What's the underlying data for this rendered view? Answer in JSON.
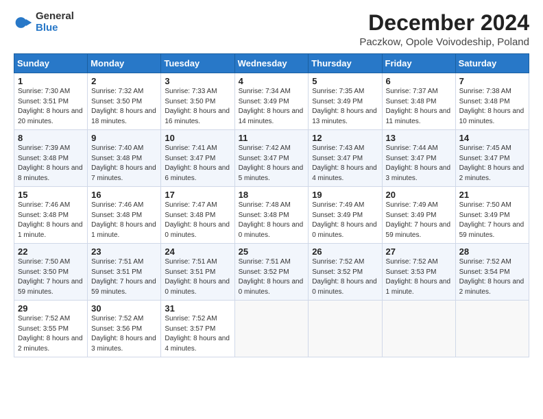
{
  "logo": {
    "general": "General",
    "blue": "Blue"
  },
  "calendar": {
    "title": "December 2024",
    "subtitle": "Paczkow, Opole Voivodeship, Poland",
    "headers": [
      "Sunday",
      "Monday",
      "Tuesday",
      "Wednesday",
      "Thursday",
      "Friday",
      "Saturday"
    ],
    "weeks": [
      [
        {
          "day": "1",
          "sunrise": "7:30 AM",
          "sunset": "3:51 PM",
          "daylight": "8 hours and 20 minutes."
        },
        {
          "day": "2",
          "sunrise": "7:32 AM",
          "sunset": "3:50 PM",
          "daylight": "8 hours and 18 minutes."
        },
        {
          "day": "3",
          "sunrise": "7:33 AM",
          "sunset": "3:50 PM",
          "daylight": "8 hours and 16 minutes."
        },
        {
          "day": "4",
          "sunrise": "7:34 AM",
          "sunset": "3:49 PM",
          "daylight": "8 hours and 14 minutes."
        },
        {
          "day": "5",
          "sunrise": "7:35 AM",
          "sunset": "3:49 PM",
          "daylight": "8 hours and 13 minutes."
        },
        {
          "day": "6",
          "sunrise": "7:37 AM",
          "sunset": "3:48 PM",
          "daylight": "8 hours and 11 minutes."
        },
        {
          "day": "7",
          "sunrise": "7:38 AM",
          "sunset": "3:48 PM",
          "daylight": "8 hours and 10 minutes."
        }
      ],
      [
        {
          "day": "8",
          "sunrise": "7:39 AM",
          "sunset": "3:48 PM",
          "daylight": "8 hours and 8 minutes."
        },
        {
          "day": "9",
          "sunrise": "7:40 AM",
          "sunset": "3:48 PM",
          "daylight": "8 hours and 7 minutes."
        },
        {
          "day": "10",
          "sunrise": "7:41 AM",
          "sunset": "3:47 PM",
          "daylight": "8 hours and 6 minutes."
        },
        {
          "day": "11",
          "sunrise": "7:42 AM",
          "sunset": "3:47 PM",
          "daylight": "8 hours and 5 minutes."
        },
        {
          "day": "12",
          "sunrise": "7:43 AM",
          "sunset": "3:47 PM",
          "daylight": "8 hours and 4 minutes."
        },
        {
          "day": "13",
          "sunrise": "7:44 AM",
          "sunset": "3:47 PM",
          "daylight": "8 hours and 3 minutes."
        },
        {
          "day": "14",
          "sunrise": "7:45 AM",
          "sunset": "3:47 PM",
          "daylight": "8 hours and 2 minutes."
        }
      ],
      [
        {
          "day": "15",
          "sunrise": "7:46 AM",
          "sunset": "3:48 PM",
          "daylight": "8 hours and 1 minute."
        },
        {
          "day": "16",
          "sunrise": "7:46 AM",
          "sunset": "3:48 PM",
          "daylight": "8 hours and 1 minute."
        },
        {
          "day": "17",
          "sunrise": "7:47 AM",
          "sunset": "3:48 PM",
          "daylight": "8 hours and 0 minutes."
        },
        {
          "day": "18",
          "sunrise": "7:48 AM",
          "sunset": "3:48 PM",
          "daylight": "8 hours and 0 minutes."
        },
        {
          "day": "19",
          "sunrise": "7:49 AM",
          "sunset": "3:49 PM",
          "daylight": "8 hours and 0 minutes."
        },
        {
          "day": "20",
          "sunrise": "7:49 AM",
          "sunset": "3:49 PM",
          "daylight": "7 hours and 59 minutes."
        },
        {
          "day": "21",
          "sunrise": "7:50 AM",
          "sunset": "3:49 PM",
          "daylight": "7 hours and 59 minutes."
        }
      ],
      [
        {
          "day": "22",
          "sunrise": "7:50 AM",
          "sunset": "3:50 PM",
          "daylight": "7 hours and 59 minutes."
        },
        {
          "day": "23",
          "sunrise": "7:51 AM",
          "sunset": "3:51 PM",
          "daylight": "7 hours and 59 minutes."
        },
        {
          "day": "24",
          "sunrise": "7:51 AM",
          "sunset": "3:51 PM",
          "daylight": "8 hours and 0 minutes."
        },
        {
          "day": "25",
          "sunrise": "7:51 AM",
          "sunset": "3:52 PM",
          "daylight": "8 hours and 0 minutes."
        },
        {
          "day": "26",
          "sunrise": "7:52 AM",
          "sunset": "3:52 PM",
          "daylight": "8 hours and 0 minutes."
        },
        {
          "day": "27",
          "sunrise": "7:52 AM",
          "sunset": "3:53 PM",
          "daylight": "8 hours and 1 minute."
        },
        {
          "day": "28",
          "sunrise": "7:52 AM",
          "sunset": "3:54 PM",
          "daylight": "8 hours and 2 minutes."
        }
      ],
      [
        {
          "day": "29",
          "sunrise": "7:52 AM",
          "sunset": "3:55 PM",
          "daylight": "8 hours and 2 minutes."
        },
        {
          "day": "30",
          "sunrise": "7:52 AM",
          "sunset": "3:56 PM",
          "daylight": "8 hours and 3 minutes."
        },
        {
          "day": "31",
          "sunrise": "7:52 AM",
          "sunset": "3:57 PM",
          "daylight": "8 hours and 4 minutes."
        },
        null,
        null,
        null,
        null
      ]
    ]
  }
}
